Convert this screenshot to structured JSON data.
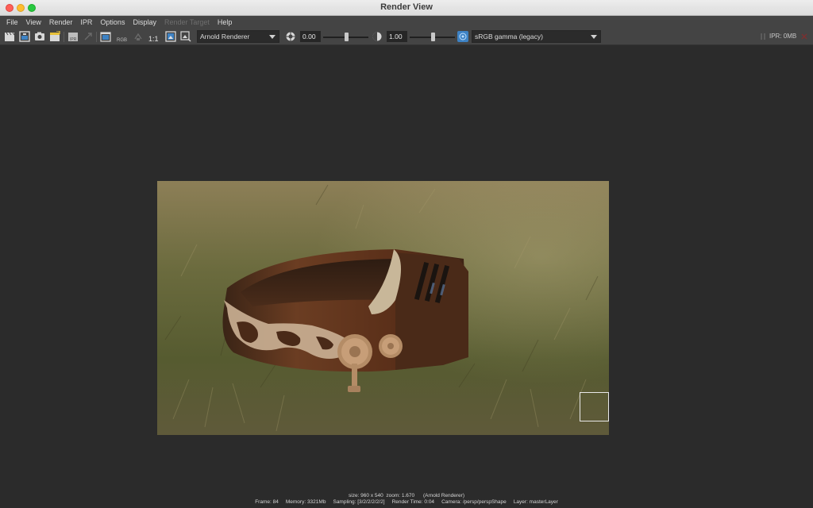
{
  "window": {
    "title": "Render View"
  },
  "menu": [
    "File",
    "View",
    "Render",
    "IPR",
    "Options",
    "Display",
    "Render Target",
    "Help"
  ],
  "menu_disabled": [
    "Render Target"
  ],
  "toolbar": {
    "rgb_label": "RGB",
    "ratio_label": "1:1",
    "renderer": "Arnold Renderer",
    "exposure_value": "0.00",
    "gamma_value": "1.00",
    "color_space": "sRGB gamma (legacy)",
    "exposure_slider_level": 0.5,
    "gamma_slider_level": 0.5,
    "ipr_label": "IPR: 0MB"
  },
  "status": {
    "line1": "size: 960 x 540  zoom: 1.670      (Arnold Renderer)",
    "frame": "Frame: 84",
    "memory": "Memory: 3321Mb",
    "sampling": "Sampling: [3/2/2/2/2/2]",
    "render_time": "Render Time: 0:04",
    "camera": "Camera: /persp/perspShape",
    "layer": "Layer: masterLayer"
  },
  "colors": {
    "accent": "#3d82c4",
    "background": "#2b2b2b",
    "toolbar": "#444444"
  },
  "icons": [
    "clapper-icon",
    "render-region-icon",
    "snapshot-icon",
    "keep-image-icon",
    "ipr-clapper-icon",
    "redo-icon",
    "render-settings-icon",
    "rgb-channel-icon",
    "pause-icon",
    "real-size-icon",
    "display-image-icon",
    "aspect-icon",
    "exposure-icon",
    "gamma-icon",
    "color-management-icon"
  ]
}
